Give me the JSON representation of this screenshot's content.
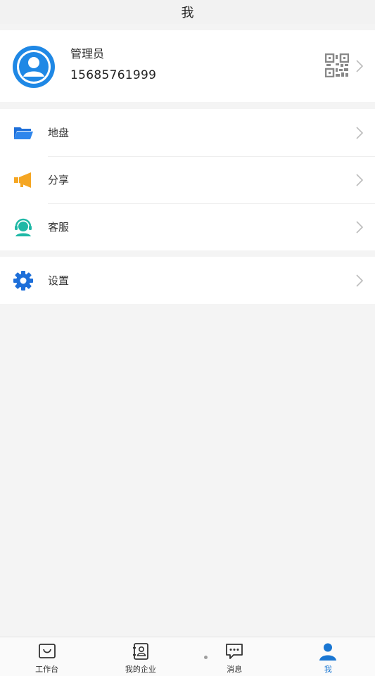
{
  "header": {
    "title": "我"
  },
  "profile": {
    "name": "管理员",
    "phone": "15685761999",
    "avatar_icon": "user-avatar-icon",
    "qr_icon": "qr-code-icon"
  },
  "menu_group_1": [
    {
      "label": "地盘",
      "icon": "folder-icon",
      "color": "#1e6fd9"
    },
    {
      "label": "分享",
      "icon": "megaphone-icon",
      "color": "#f5a623"
    },
    {
      "label": "客服",
      "icon": "customer-service-icon",
      "color": "#1fb8a6"
    }
  ],
  "menu_group_2": [
    {
      "label": "设置",
      "icon": "gear-icon",
      "color": "#1e6fd9"
    }
  ],
  "bottom_nav": {
    "items": [
      {
        "label": "工作台",
        "icon": "workbench-icon"
      },
      {
        "label": "我的企业",
        "icon": "company-icon"
      },
      {
        "label": "消息",
        "icon": "message-icon"
      },
      {
        "label": "我",
        "icon": "person-icon"
      }
    ],
    "active_index": 3
  },
  "colors": {
    "accent": "#1976d2",
    "background": "#f4f4f4"
  }
}
